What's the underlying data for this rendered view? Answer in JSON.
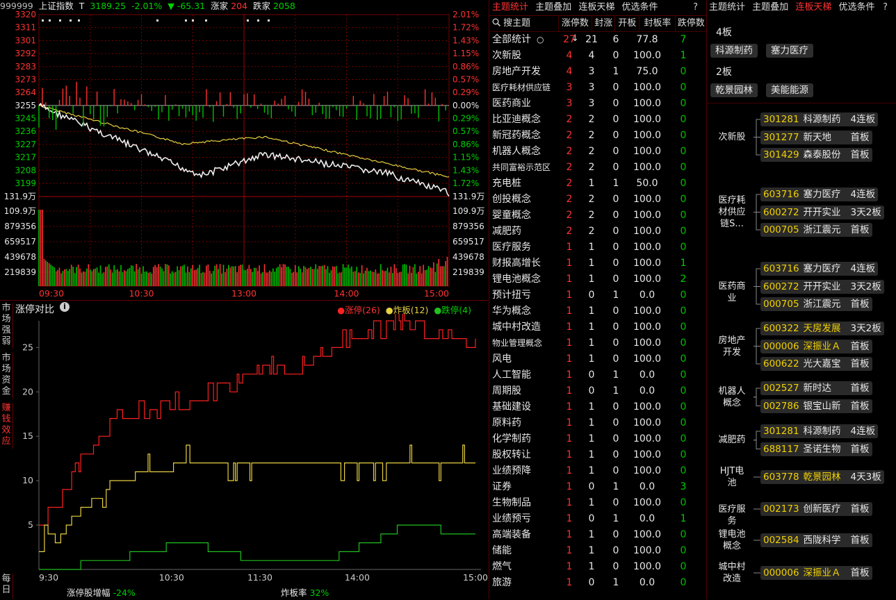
{
  "index_header": {
    "code": "999999",
    "name": "上证指数",
    "t_label": "T",
    "price": "3189.25",
    "pct": "-2.01%",
    "arrow": "▼",
    "change": "-65.31",
    "up_label": "涨家",
    "up_count": "204",
    "down_label": "跌家",
    "down_count": "2058"
  },
  "price_axis_left": [
    "3320",
    "3311",
    "3301",
    "3292",
    "3283",
    "3273",
    "3264",
    "3255",
    "3245",
    "3236",
    "3227",
    "3217",
    "3208",
    "3199"
  ],
  "price_axis_right": [
    "2.01%",
    "1.72%",
    "1.43%",
    "1.15%",
    "0.86%",
    "0.57%",
    "0.29%",
    "0.00%",
    "0.29%",
    "0.57%",
    "0.86%",
    "1.15%",
    "1.43%",
    "1.72%"
  ],
  "volume_axis": [
    "131.9万",
    "109.9万",
    "879356",
    "659517",
    "439678",
    "219839"
  ],
  "time_axis": [
    "09:30",
    "10:30",
    "13:00",
    "14:00",
    "15:00"
  ],
  "chart2": {
    "title": "涨停对比",
    "legend": [
      {
        "label": "涨停(26)",
        "color": "#ff2020"
      },
      {
        "label": "炸板(12)",
        "color": "#e8d040"
      },
      {
        "label": "跌停(4)",
        "color": "#20c020"
      }
    ],
    "y_ticks": [
      "25",
      "20",
      "15",
      "10",
      "5"
    ],
    "x_ticks": [
      "9:30",
      "10:30",
      "11:30",
      "14:00",
      "15:00"
    ],
    "footer_label1": "涨停股增幅",
    "footer_val1": "-24%",
    "footer_label2": "炸板率",
    "footer_val2": "32%"
  },
  "chart_data": {
    "type": "line",
    "x": [
      "9:30",
      "10:30",
      "11:30",
      "14:00",
      "15:00"
    ],
    "ylim": [
      0,
      28
    ],
    "series": [
      {
        "name": "涨停(26)",
        "values": [
          5,
          17,
          19,
          22,
          25,
          28,
          25
        ]
      },
      {
        "name": "炸板(12)",
        "values": [
          2,
          10,
          12,
          12,
          12,
          12,
          12
        ]
      },
      {
        "name": "跌停(4)",
        "values": [
          0,
          1,
          3,
          1,
          1,
          5,
          4
        ]
      }
    ]
  },
  "side_tabs": [
    {
      "label": "市场强弱",
      "active": false
    },
    {
      "label": "市场资金",
      "active": false
    },
    {
      "label": "赚钱效应",
      "active": true
    },
    {
      "label": "每日",
      "active": false
    }
  ],
  "theme_panel": {
    "tabs": [
      "主题统计",
      "主题叠加",
      "连板天梯",
      "优选条件"
    ],
    "active_tab": 0,
    "help": "?",
    "headers": [
      "搜主题",
      "涨停数↓",
      "封涨",
      "开板",
      "封板率",
      "跌停数"
    ],
    "search_icon": "search-icon",
    "rows": [
      [
        "全部统计",
        "27",
        "21",
        "6",
        "77.8",
        "7"
      ],
      [
        "次新股",
        "4",
        "4",
        "0",
        "100.0",
        "1"
      ],
      [
        "房地产开发",
        "4",
        "3",
        "1",
        "75.0",
        "0"
      ],
      [
        "医疗耗材供应链",
        "3",
        "3",
        "0",
        "100.0",
        "0"
      ],
      [
        "医药商业",
        "3",
        "3",
        "0",
        "100.0",
        "0"
      ],
      [
        "比亚迪概念",
        "2",
        "2",
        "0",
        "100.0",
        "0"
      ],
      [
        "新冠药概念",
        "2",
        "2",
        "0",
        "100.0",
        "0"
      ],
      [
        "机器人概念",
        "2",
        "2",
        "0",
        "100.0",
        "0"
      ],
      [
        "共同富裕示范区",
        "2",
        "2",
        "0",
        "100.0",
        "0"
      ],
      [
        "充电桩",
        "2",
        "1",
        "1",
        "50.0",
        "0"
      ],
      [
        "创投概念",
        "2",
        "2",
        "0",
        "100.0",
        "0"
      ],
      [
        "婴童概念",
        "2",
        "2",
        "0",
        "100.0",
        "0"
      ],
      [
        "减肥药",
        "2",
        "2",
        "0",
        "100.0",
        "0"
      ],
      [
        "医疗服务",
        "1",
        "1",
        "0",
        "100.0",
        "0"
      ],
      [
        "财报高增长",
        "1",
        "1",
        "0",
        "100.0",
        "1"
      ],
      [
        "锂电池概念",
        "1",
        "1",
        "0",
        "100.0",
        "2"
      ],
      [
        "预计扭亏",
        "1",
        "0",
        "1",
        "0.0",
        "0"
      ],
      [
        "华为概念",
        "1",
        "1",
        "0",
        "100.0",
        "0"
      ],
      [
        "城中村改造",
        "1",
        "1",
        "0",
        "100.0",
        "0"
      ],
      [
        "物业管理概念",
        "1",
        "1",
        "0",
        "100.0",
        "0"
      ],
      [
        "风电",
        "1",
        "1",
        "0",
        "100.0",
        "0"
      ],
      [
        "人工智能",
        "1",
        "0",
        "1",
        "0.0",
        "0"
      ],
      [
        "周期股",
        "1",
        "0",
        "1",
        "0.0",
        "0"
      ],
      [
        "基础建设",
        "1",
        "1",
        "0",
        "100.0",
        "0"
      ],
      [
        "原料药",
        "1",
        "1",
        "0",
        "100.0",
        "0"
      ],
      [
        "化学制药",
        "1",
        "1",
        "0",
        "100.0",
        "0"
      ],
      [
        "股权转让",
        "1",
        "1",
        "0",
        "100.0",
        "0"
      ],
      [
        "业绩预降",
        "1",
        "1",
        "0",
        "100.0",
        "0"
      ],
      [
        "证券",
        "1",
        "0",
        "1",
        "0.0",
        "3"
      ],
      [
        "生物制品",
        "1",
        "1",
        "0",
        "100.0",
        "0"
      ],
      [
        "业绩预亏",
        "1",
        "0",
        "1",
        "0.0",
        "1"
      ],
      [
        "高端装备",
        "1",
        "1",
        "0",
        "100.0",
        "0"
      ],
      [
        "储能",
        "1",
        "1",
        "0",
        "100.0",
        "0"
      ],
      [
        "燃气",
        "1",
        "1",
        "0",
        "100.0",
        "0"
      ],
      [
        "旅游",
        "1",
        "0",
        "1",
        "0.0",
        "0"
      ]
    ]
  },
  "ladder_panel": {
    "tabs": [
      "主题统计",
      "主题叠加",
      "连板天梯",
      "优选条件"
    ],
    "active_tab": 2,
    "help": "?",
    "boards": [
      {
        "title": "4板",
        "chips": [
          "科源制药",
          "塞力医疗"
        ]
      },
      {
        "title": "2板",
        "chips": [
          "乾景园林",
          "美能能源"
        ]
      }
    ],
    "groups": [
      {
        "label": "次新股",
        "stocks": [
          [
            "301281",
            "科源制药",
            "4连板",
            false
          ],
          [
            "301277",
            "新天地",
            "首板",
            false
          ],
          [
            "301429",
            "森泰股份",
            "首板",
            false
          ]
        ]
      },
      {
        "label": "医疗耗材供应链S...",
        "stocks": [
          [
            "603716",
            "塞力医疗",
            "4连板",
            false
          ],
          [
            "600272",
            "开开实业",
            "3天2板",
            false
          ],
          [
            "000705",
            "浙江震元",
            "首板",
            false
          ]
        ]
      },
      {
        "label": "医药商业",
        "stocks": [
          [
            "603716",
            "塞力医疗",
            "4连板",
            false
          ],
          [
            "600272",
            "开开实业",
            "3天2板",
            false
          ],
          [
            "000705",
            "浙江震元",
            "首板",
            false
          ]
        ]
      },
      {
        "label": "房地产开发",
        "stocks": [
          [
            "600322",
            "天房发展",
            "3天2板",
            true
          ],
          [
            "000006",
            "深振业Ａ",
            "首板",
            true
          ],
          [
            "600622",
            "光大嘉宝",
            "首板",
            false
          ]
        ]
      },
      {
        "label": "机器人概念",
        "stocks": [
          [
            "002527",
            "新时达",
            "首板",
            false
          ],
          [
            "002786",
            "银宝山新",
            "首板",
            false
          ]
        ]
      },
      {
        "label": "减肥药",
        "stocks": [
          [
            "301281",
            "科源制药",
            "4连板",
            false
          ],
          [
            "688117",
            "圣诺生物",
            "首板",
            false
          ]
        ]
      },
      {
        "label": "HJT电池",
        "stocks": [
          [
            "603778",
            "乾景园林",
            "4天3板",
            true
          ]
        ]
      },
      {
        "label": "医疗服务",
        "stocks": [
          [
            "002173",
            "创新医疗",
            "首板",
            false
          ]
        ]
      },
      {
        "label": "锂电池概念",
        "stocks": [
          [
            "002584",
            "西陇科学",
            "首板",
            false
          ]
        ]
      },
      {
        "label": "城中村改造",
        "stocks": [
          [
            "000006",
            "深振业Ａ",
            "首板",
            true
          ]
        ]
      }
    ]
  }
}
